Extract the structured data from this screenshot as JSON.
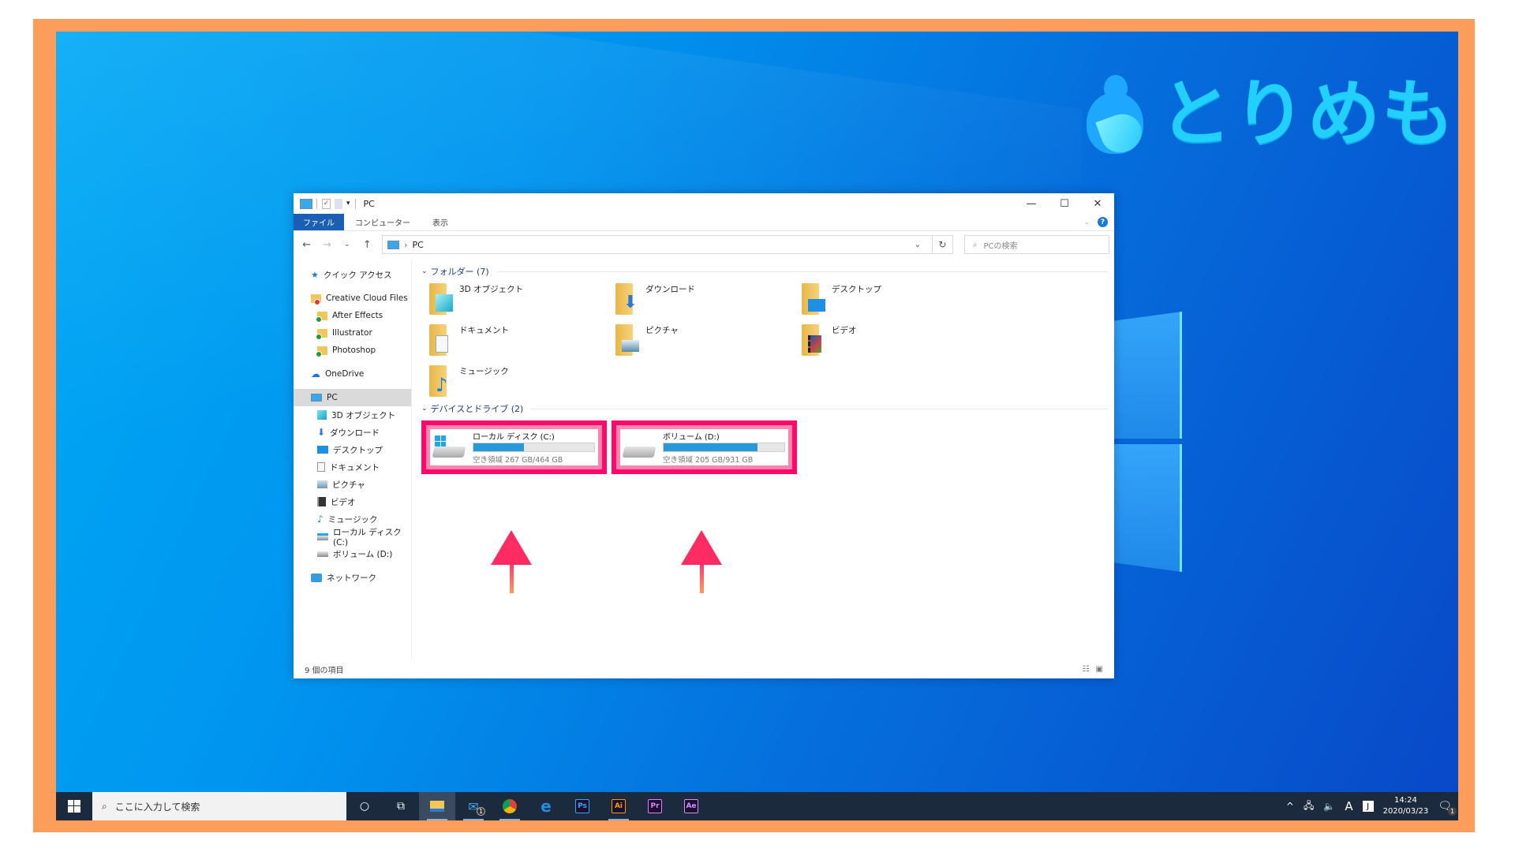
{
  "logo": {
    "text": "とりめも"
  },
  "window": {
    "title": "PC",
    "controls": {
      "minimize": "—",
      "maximize": "☐",
      "close": "✕"
    },
    "ribbon_tabs": [
      {
        "label": "ファイル",
        "active": true
      },
      {
        "label": "コンピューター",
        "active": false
      },
      {
        "label": "表示",
        "active": false
      }
    ],
    "help_label": "?",
    "address": {
      "path": [
        "PC"
      ],
      "separator": "›"
    },
    "search": {
      "placeholder": "PCの検索"
    },
    "sidebar": [
      {
        "label": "クイック アクセス",
        "icon": "star-icon",
        "level": 1
      },
      {
        "label": "Creative Cloud Files",
        "icon": "creative-cloud-folder-icon",
        "level": 1,
        "gap": true
      },
      {
        "label": "After Effects",
        "icon": "synced-folder-icon",
        "level": 2
      },
      {
        "label": "Illustrator",
        "icon": "synced-folder-icon",
        "level": 2
      },
      {
        "label": "Photoshop",
        "icon": "synced-folder-icon",
        "level": 2
      },
      {
        "label": "OneDrive",
        "icon": "cloud-icon",
        "level": 1,
        "gap": true
      },
      {
        "label": "PC",
        "icon": "pc-icon",
        "level": 1,
        "gap": true,
        "selected": true
      },
      {
        "label": "3D オブジェクト",
        "icon": "3d-objects-icon",
        "level": 2
      },
      {
        "label": "ダウンロード",
        "icon": "download-icon",
        "level": 2
      },
      {
        "label": "デスクトップ",
        "icon": "desktop-icon",
        "level": 2
      },
      {
        "label": "ドキュメント",
        "icon": "document-icon",
        "level": 2
      },
      {
        "label": "ピクチャ",
        "icon": "pictures-icon",
        "level": 2
      },
      {
        "label": "ビデオ",
        "icon": "video-icon",
        "level": 2
      },
      {
        "label": "ミュージック",
        "icon": "music-icon",
        "level": 2
      },
      {
        "label": "ローカル ディスク (C:)",
        "icon": "local-disk-icon",
        "level": 2
      },
      {
        "label": "ボリューム (D:)",
        "icon": "drive-icon",
        "level": 2
      },
      {
        "label": "ネットワーク",
        "icon": "network-icon",
        "level": 1,
        "gap": true
      }
    ],
    "folders_group": {
      "label": "フォルダー (7)",
      "items": [
        {
          "label": "3D オブジェクト",
          "icon": "3d-objects-folder-icon"
        },
        {
          "label": "ダウンロード",
          "icon": "downloads-folder-icon"
        },
        {
          "label": "デスクトップ",
          "icon": "desktop-folder-icon"
        },
        {
          "label": "ドキュメント",
          "icon": "documents-folder-icon"
        },
        {
          "label": "ピクチャ",
          "icon": "pictures-folder-icon"
        },
        {
          "label": "ビデオ",
          "icon": "videos-folder-icon"
        },
        {
          "label": "ミュージック",
          "icon": "music-folder-icon"
        }
      ]
    },
    "drives_group": {
      "label": "デバイスとドライブ (2)",
      "items": [
        {
          "label": "ローカル ディスク (C:)",
          "free": "空き領域 267 GB/464 GB",
          "used_fraction": 0.42,
          "windows": true
        },
        {
          "label": "ボリューム (D:)",
          "free": "空き領域 205 GB/931 GB",
          "used_fraction": 0.78,
          "windows": false
        }
      ]
    },
    "status": {
      "count": "9 個の項目"
    }
  },
  "annotation": {
    "highlight_color": "#ff0a6a",
    "arrow_color": "#ff2b62"
  },
  "taskbar": {
    "search_placeholder": "ここに入力して検索",
    "apps": [
      {
        "name": "cortana",
        "glyph": "○"
      },
      {
        "name": "task-view",
        "glyph": "⧉"
      },
      {
        "name": "file-explorer",
        "glyph": "📁",
        "active": true
      },
      {
        "name": "mail",
        "glyph": "✉",
        "badge": "1"
      },
      {
        "name": "chrome",
        "glyph": "◉"
      },
      {
        "name": "edge",
        "glyph": "e"
      },
      {
        "name": "photoshop",
        "glyph": "Ps",
        "color": "#31a8ff"
      },
      {
        "name": "illustrator",
        "glyph": "Ai",
        "color": "#ff9a00"
      },
      {
        "name": "premiere",
        "glyph": "Pr",
        "color": "#e77cff"
      },
      {
        "name": "after-effects",
        "glyph": "Ae",
        "color": "#d291ff"
      }
    ],
    "tray": {
      "chevron": "^",
      "ime": "A",
      "time": "14:24",
      "date": "2020/03/23",
      "notifications": "1"
    }
  }
}
